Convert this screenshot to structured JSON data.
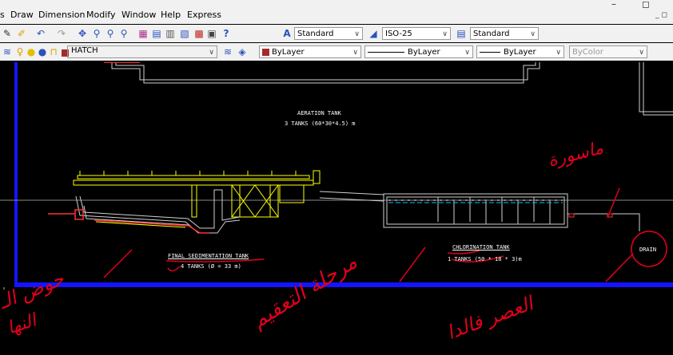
{
  "window": {
    "minimize_glyph": "–",
    "restore_glyph": "◻",
    "inner_restore_glyph": "_ ◻"
  },
  "menu": [
    "s",
    "Draw",
    "Dimension",
    "Modify",
    "Window",
    "Help",
    "Express"
  ],
  "toolbar": {
    "text_style": "Standard",
    "dim_style": "ISO-25",
    "table_style": "Standard",
    "layer": "HATCH",
    "color": "ByLayer",
    "linetype": "ByLayer",
    "lineweight": "ByLayer",
    "plot_style": "ByColor"
  },
  "drawing": {
    "aeration_title": "AERATION TANK",
    "aeration_sub": "3 TANKS (60*30*4.5) m",
    "sed_title": "FINAL SEDIMENTATION TANK",
    "sed_sub": "4 TANKS (Ø = 33 m)",
    "chl_title": "CHLORINATION TANK",
    "chl_sub": "1 TANKS (50 * 18 * 3)m",
    "drain": "DRAIN"
  },
  "annotations": {
    "ink": "#e0001b",
    "pipe_note": "ماسورة",
    "left_note_1": "حوض الـ",
    "left_note_2": "النها",
    "middle_note": "مرحلة التعقيم",
    "bottom_note": "العصر فالدا"
  },
  "colors": {
    "frame": "#1414ff",
    "structure": "#ffff00",
    "water": "#00c8ff",
    "detail": "#ff2a2a"
  }
}
